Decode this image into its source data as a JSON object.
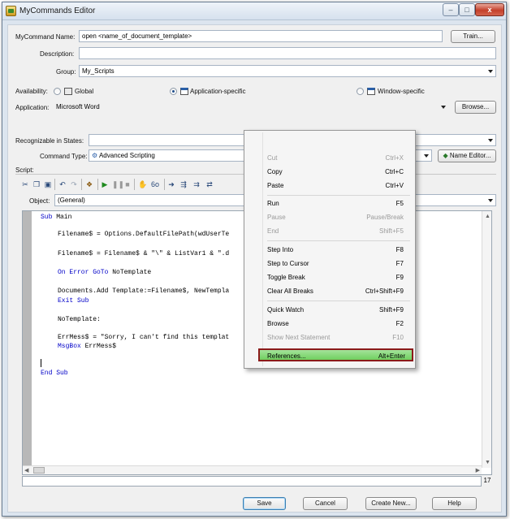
{
  "window": {
    "title": "MyCommands Editor",
    "controls": [
      "–",
      "□",
      "x"
    ]
  },
  "form": {
    "mycommand_name_label": "MyCommand Name:",
    "mycommand_name_value": "open <name_of_document_template>",
    "train_button": "Train...",
    "description_label": "Description:",
    "description_value": "",
    "group_label": "Group:",
    "group_value": "My_Scripts",
    "availability_label": "Availability:",
    "availability_options": [
      "Global",
      "Application-specific",
      "Window-specific"
    ],
    "availability_selected": "Application-specific",
    "application_label": "Application:",
    "application_value": "Microsoft Word",
    "browse_button": "Browse...",
    "states_label": "Recognizable in States:",
    "states_value": "",
    "command_type_label": "Command Type:",
    "command_type_value": "Advanced Scripting",
    "name_editor_button": "Name Editor...",
    "script_label": "Script:",
    "object_label": "Object:",
    "object_value": "(General)"
  },
  "toolbar_icons": [
    "cut-icon",
    "copy-icon",
    "paste-icon",
    "undo-icon",
    "redo-icon",
    "dialog-editor-icon",
    "run-icon",
    "pause-icon",
    "stop-icon",
    "toggle-breakpoint-icon",
    "quick-watch-icon",
    "step-into-icon",
    "step-to-cursor-icon",
    "step-over-icon"
  ],
  "code": {
    "l1_kw": "Sub",
    "l1_rest": " Main",
    "l2": "Filename$ = Options.DefaultFilePath(wdUserTe",
    "l3": "Filename$ = Filename$ & \"\\\" & ListVar1 & \".d",
    "l4_kw": "On Error GoTo",
    "l4_rest": " NoTemplate",
    "l5": "Documents.Add Template:=Filename$, NewTempla",
    "l6_kw": "Exit Sub",
    "l7": "NoTemplate:",
    "l8": "ErrMess$ = \"Sorry, I can't find this templat",
    "l9_kw": "MsgBox",
    "l9_rest": " ErrMess$",
    "l10_kw": "End Sub"
  },
  "line_number": "17",
  "context_menu": [
    {
      "label": "Cut",
      "key": "Ctrl+X",
      "enabled": false
    },
    {
      "label": "Copy",
      "key": "Ctrl+C",
      "enabled": true
    },
    {
      "label": "Paste",
      "key": "Ctrl+V",
      "enabled": true
    },
    {
      "label": "Run",
      "key": "F5",
      "enabled": true
    },
    {
      "label": "Pause",
      "key": "Pause/Break",
      "enabled": false
    },
    {
      "label": "End",
      "key": "Shift+F5",
      "enabled": false
    },
    {
      "label": "Step Into",
      "key": "F8",
      "enabled": true
    },
    {
      "label": "Step to Cursor",
      "key": "F7",
      "enabled": true
    },
    {
      "label": "Toggle Break",
      "key": "F9",
      "enabled": true
    },
    {
      "label": "Clear All Breaks",
      "key": "Ctrl+Shift+F9",
      "enabled": true
    },
    {
      "label": "Quick Watch",
      "key": "Shift+F9",
      "enabled": true
    },
    {
      "label": "Browse",
      "key": "F2",
      "enabled": true
    },
    {
      "label": "Show Next Statement",
      "key": "F10",
      "enabled": false
    },
    {
      "label": "References...",
      "key": "Alt+Enter",
      "enabled": true,
      "highlighted": true
    }
  ],
  "footer": {
    "save": "Save",
    "cancel": "Cancel",
    "create_new": "Create New...",
    "help": "Help"
  },
  "colors": {
    "highlight": "#6fcf5f",
    "highlight_border": "#8b1a1a",
    "keyword": "#0000c8"
  }
}
